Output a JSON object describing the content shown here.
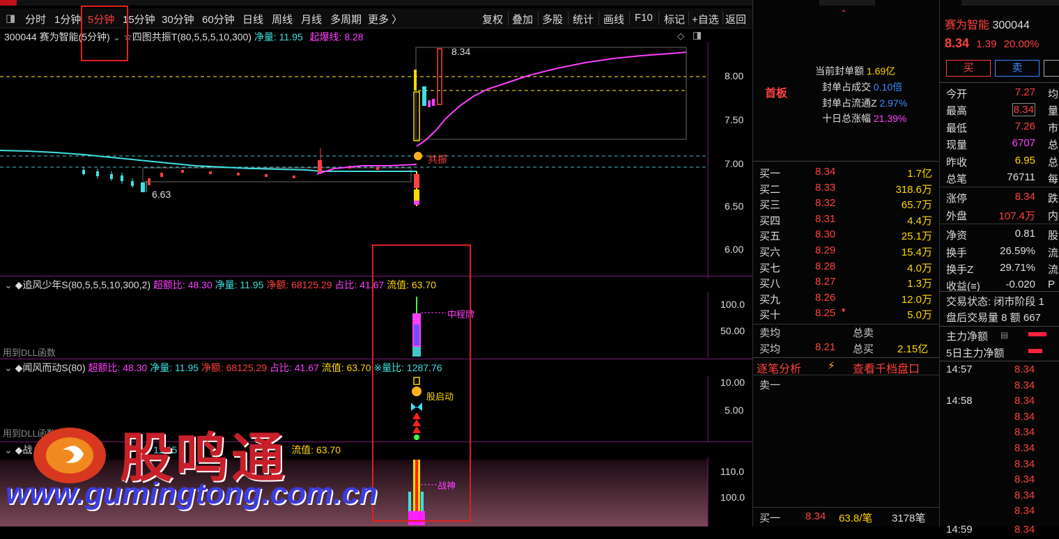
{
  "toolbar": {
    "periods": [
      "分时",
      "1分钟",
      "5分钟",
      "15分钟",
      "30分钟",
      "60分钟",
      "日线",
      "周线",
      "月线",
      "多周期",
      "更多 〉"
    ],
    "active_period": "5分钟",
    "right_items": [
      "复权",
      "叠加",
      "多股",
      "统计",
      "画线",
      "F10",
      "标记",
      "+自选",
      "返回"
    ]
  },
  "main_chart": {
    "stock_label": "300044 赛为智能(5分钟)",
    "indicator_name": "☆四图共振T(80,5,5,5,10,300)",
    "net_label": "净量: 11.95",
    "explode_label": "起爆线: 8.28",
    "high_mark": "8.34",
    "low_mark": "6.63",
    "resonance": "共振",
    "y_ticks": [
      "8.00",
      "7.50",
      "7.00",
      "6.50",
      "6.00"
    ]
  },
  "panel2": {
    "title": "◆追风少年S(80,5,5,5,10,300,2)",
    "fields": [
      {
        "label": "超额比: 48.30",
        "color": "#ff40ff"
      },
      {
        "label": "净量: 11.95",
        "color": "#40e0e0"
      },
      {
        "label": "净额: 68125.29",
        "color": "#ff4040"
      },
      {
        "label": "占比: 41.67",
        "color": "#ff40ff"
      },
      {
        "label": "流值: 63.70",
        "color": "#ffd700"
      }
    ],
    "mark": "中程牌",
    "dll": "用到DLL函数",
    "y_ticks": [
      "100.0",
      "50.00"
    ]
  },
  "panel3": {
    "title": "◆闻风而动S(80)",
    "fields": [
      {
        "label": "超额比: 48.30",
        "color": "#ff40ff"
      },
      {
        "label": "净量: 11.95",
        "color": "#40e0e0"
      },
      {
        "label": "净额: 68125.29",
        "color": "#ff4040"
      },
      {
        "label": "占比: 41.67",
        "color": "#ff40ff"
      },
      {
        "label": "流值: 63.70",
        "color": "#ffd700"
      },
      {
        "label": "※量比: 1287.76",
        "color": "#40e0e0"
      }
    ],
    "mark": "股启动",
    "dll": "用到DLL函数",
    "y_ticks": [
      "10.00",
      "5.00"
    ]
  },
  "panel4": {
    "title": "◆战",
    "fields": [
      {
        "label": "11.95",
        "color": "#40e0e0"
      },
      {
        "label": "流值: 63.70",
        "color": "#ffd700"
      }
    ],
    "mark": "战神",
    "y_ticks": [
      "110.0",
      "100.0"
    ]
  },
  "watermark": {
    "brand": "股鸣通",
    "url": "www.gumingtong.com.cn"
  },
  "order_panel": {
    "board": "首板",
    "seal_amount_label": "当前封单额",
    "seal_amount": "1.69亿",
    "seal_ratio_label": "封单占成交",
    "seal_ratio": "0.10倍",
    "seal_float_label": "封单占流通Z",
    "seal_float": "2.97%",
    "ten_day_label": "十日总涨幅",
    "ten_day": "21.39%",
    "bids": [
      {
        "name": "买一",
        "price": "8.34",
        "vol": "1.7亿"
      },
      {
        "name": "买二",
        "price": "8.33",
        "vol": "318.6万"
      },
      {
        "name": "买三",
        "price": "8.32",
        "vol": "65.7万"
      },
      {
        "name": "买四",
        "price": "8.31",
        "vol": "4.4万"
      },
      {
        "name": "买五",
        "price": "8.30",
        "vol": "25.1万"
      },
      {
        "name": "买六",
        "price": "8.29",
        "vol": "15.4万"
      },
      {
        "name": "买七",
        "price": "8.28",
        "vol": "4.0万"
      },
      {
        "name": "买八",
        "price": "8.27",
        "vol": "1.3万"
      },
      {
        "name": "买九",
        "price": "8.26",
        "vol": "12.0万"
      },
      {
        "name": "买十",
        "price": "8.25",
        "vol": "5.0万"
      }
    ],
    "sell_avg_label": "卖均",
    "total_sell_label": "总卖",
    "buy_avg_label": "买均",
    "buy_avg": "8.21",
    "total_buy_label": "总买",
    "total_buy": "2.15亿",
    "tick_analysis": "逐笔分析",
    "view_depth": "查看千档盘口",
    "sell1": "卖一",
    "bottom_name": "买一",
    "bottom_price": "8.34",
    "bottom_per": "63.8/笔",
    "bottom_count": "3178笔"
  },
  "quote_panel": {
    "name": "赛为智能",
    "code": "300044",
    "price": "8.34",
    "change": "1.39",
    "pct": "20.00%",
    "buy_btn": "买",
    "sell_btn": "卖",
    "rows": [
      {
        "label": "今开",
        "value": "7.27",
        "color": "#ff4040",
        "tail": "均"
      },
      {
        "label": "最高",
        "value": "8.34",
        "color": "#ff4040",
        "tail": "量"
      },
      {
        "label": "最低",
        "value": "7.26",
        "color": "#ff4040",
        "tail": "市"
      },
      {
        "label": "现量",
        "value": "6707",
        "color": "#ff40ff",
        "tail": "总"
      },
      {
        "label": "昨收",
        "value": "6.95",
        "color": "#ffd700",
        "tail": "总"
      },
      {
        "label": "总笔",
        "value": "76711",
        "color": "#ddd",
        "tail": "每"
      },
      {
        "label": "涨停",
        "value": "8.34",
        "color": "#ff4040",
        "tail": "跌"
      },
      {
        "label": "外盘",
        "value": "107.4万",
        "color": "#ff4040",
        "tail": "内"
      },
      {
        "label": "净资",
        "value": "0.81",
        "color": "#ddd",
        "tail": "股"
      },
      {
        "label": "换手",
        "value": "26.59%",
        "color": "#ddd",
        "tail": "流"
      },
      {
        "label": "换手Z",
        "value": "29.71%",
        "color": "#ddd",
        "tail": "流"
      },
      {
        "label": "收益(≡)",
        "value": "-0.020",
        "color": "#ddd",
        "tail": "P"
      }
    ],
    "trade_status": "交易状态: 闭市阶段 1",
    "after_hours": "盘后交易量 8 额 667",
    "main_net": "主力净额",
    "five_day_net": "5日主力净额",
    "ticks": [
      {
        "time": "14:57",
        "price": "8.34"
      },
      {
        "time": "",
        "price": "8.34"
      },
      {
        "time": "14:58",
        "price": "8.34"
      },
      {
        "time": "",
        "price": "8.34"
      },
      {
        "time": "",
        "price": "8.34"
      },
      {
        "time": "",
        "price": "8.34"
      },
      {
        "time": "",
        "price": "8.34"
      },
      {
        "time": "",
        "price": "8.34"
      },
      {
        "time": "",
        "price": "8.34"
      },
      {
        "time": "",
        "price": "8.34"
      },
      {
        "time": "14:59",
        "price": "8.34"
      }
    ]
  }
}
